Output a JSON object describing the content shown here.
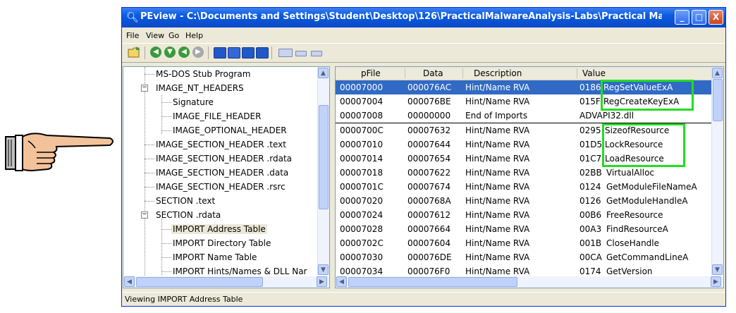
{
  "window": {
    "title": "PEview - C:\\Documents and Settings\\Student\\Desktop\\126\\PracticalMalwareAnalysis-Labs\\Practical Malware A...",
    "minimize": "_",
    "maximize": "□",
    "close": "X"
  },
  "menu": {
    "file": "File",
    "view": "View",
    "go": "Go",
    "help": "Help"
  },
  "tree": [
    "MS-DOS Stub Program",
    "IMAGE_NT_HEADERS",
    "Signature",
    "IMAGE_FILE_HEADER",
    "IMAGE_OPTIONAL_HEADER",
    "IMAGE_SECTION_HEADER .text",
    "IMAGE_SECTION_HEADER .rdata",
    "IMAGE_SECTION_HEADER .data",
    "IMAGE_SECTION_HEADER .rsrc",
    "SECTION .text",
    "SECTION .rdata",
    "IMPORT Address Table",
    "IMPORT Directory Table",
    "IMPORT Name Table",
    "IMPORT Hints/Names & DLL Nar"
  ],
  "table": {
    "headers": [
      "pFile",
      "Data",
      "Description",
      "Value"
    ],
    "rows": [
      [
        "00007000",
        "000076AC",
        "Hint/Name RVA",
        "0186",
        "RegSetValueExA"
      ],
      [
        "00007004",
        "000076BE",
        "Hint/Name RVA",
        "015F",
        "RegCreateKeyExA"
      ],
      [
        "00007008",
        "00000000",
        "End of Imports",
        "",
        "ADVAPI32.dll"
      ],
      [
        "0000700C",
        "00007632",
        "Hint/Name RVA",
        "0295",
        "SizeofResource"
      ],
      [
        "00007010",
        "00007644",
        "Hint/Name RVA",
        "01D5",
        "LockResource"
      ],
      [
        "00007014",
        "00007654",
        "Hint/Name RVA",
        "01C7",
        "LoadResource"
      ],
      [
        "00007018",
        "00007622",
        "Hint/Name RVA",
        "02BB",
        "VirtualAlloc"
      ],
      [
        "0000701C",
        "00007674",
        "Hint/Name RVA",
        "0124",
        "GetModuleFileNameA"
      ],
      [
        "00007020",
        "0000768A",
        "Hint/Name RVA",
        "0126",
        "GetModuleHandleA"
      ],
      [
        "00007024",
        "00007612",
        "Hint/Name RVA",
        "00B6",
        "FreeResource"
      ],
      [
        "00007028",
        "00007664",
        "Hint/Name RVA",
        "00A3",
        "FindResourceA"
      ],
      [
        "0000702C",
        "00007604",
        "Hint/Name RVA",
        "001B",
        "CloseHandle"
      ],
      [
        "00007030",
        "000076DE",
        "Hint/Name RVA",
        "00CA",
        "GetCommandLineA"
      ],
      [
        "00007034",
        "000076F0",
        "Hint/Name RVA",
        "0174",
        "GetVersion"
      ]
    ]
  },
  "status": "Viewing IMPORT Address Table",
  "colors": {
    "highlight_box": "#22dd22",
    "selection": "#316ac5"
  },
  "icons": [
    "pointing-hand-icon",
    "magnifier-icon",
    "open-folder-icon"
  ]
}
